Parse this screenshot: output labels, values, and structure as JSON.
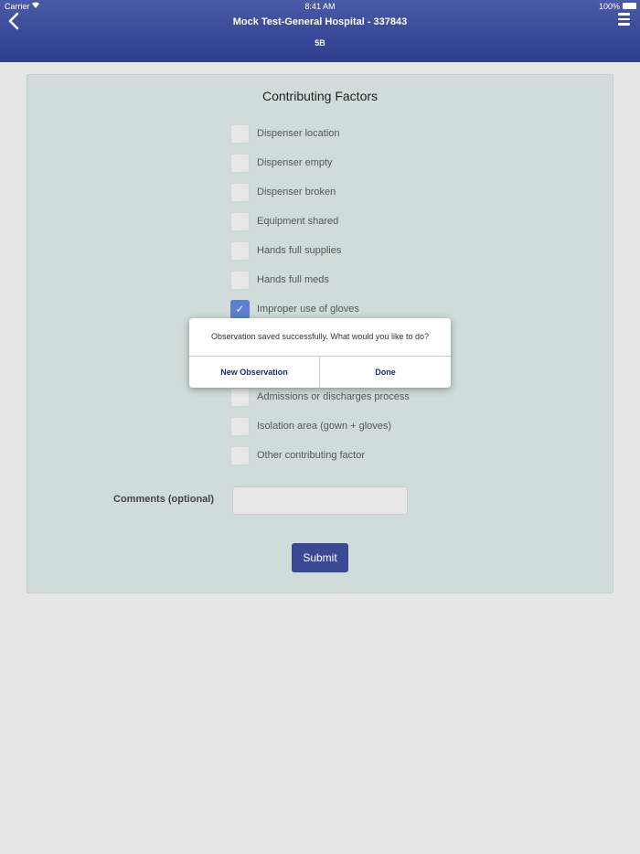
{
  "status_bar": {
    "carrier": "Carrier",
    "time": "8:41 AM",
    "battery": "100%"
  },
  "header": {
    "title": "Mock Test-General Hospital - 337843",
    "subtitle": "5B",
    "back_icon": "chevron-left-icon",
    "menu_icon": "hamburger-icon"
  },
  "panel": {
    "title": "Contributing Factors",
    "factors": [
      {
        "label": "Dispenser location",
        "checked": false
      },
      {
        "label": "Dispenser empty",
        "checked": false
      },
      {
        "label": "Dispenser broken",
        "checked": false
      },
      {
        "label": "Equipment shared",
        "checked": false
      },
      {
        "label": "Hands full supplies",
        "checked": false
      },
      {
        "label": "Hands full meds",
        "checked": false
      },
      {
        "label": "Improper use of gloves",
        "checked": true
      },
      {
        "label": "Admissions or discharges process",
        "checked": false
      },
      {
        "label": "Isolation area (gown + gloves)",
        "checked": false
      },
      {
        "label": "Other contributing factor",
        "checked": false
      }
    ],
    "comments_label": "Comments (optional)",
    "comments_value": "",
    "submit_label": "Submit"
  },
  "dialog": {
    "message": "Observation saved successfully. What would you like to do?",
    "new_observation_label": "New Observation",
    "done_label": "Done"
  },
  "colors": {
    "header": "#3b4894",
    "panel": "#cfdcd9",
    "checked": "#5d7fcf"
  }
}
